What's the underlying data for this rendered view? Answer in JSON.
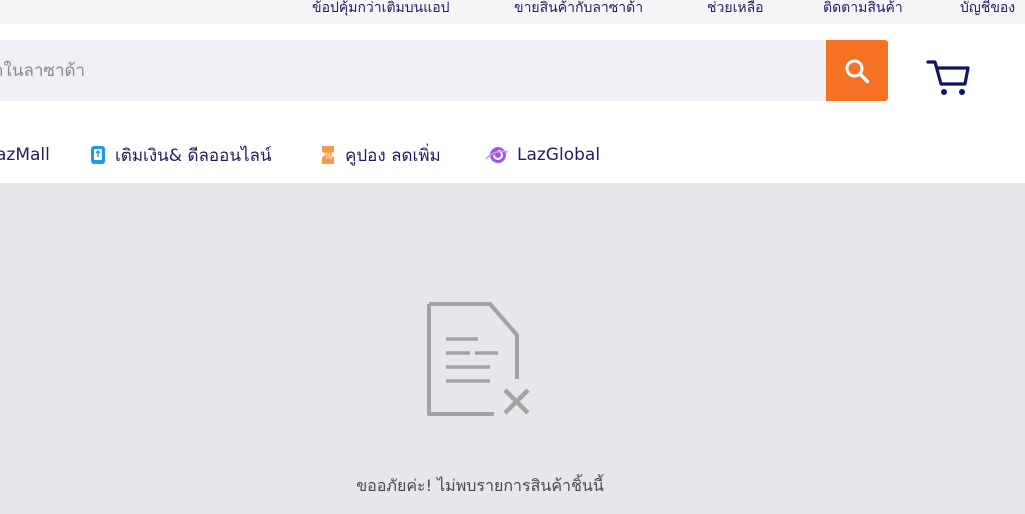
{
  "topbar": {
    "links": [
      "ข้อปคุ้มกว่าเติมบนแอป",
      "ขายสินค้ากับลาซาด้า",
      "ช่วยเหลือ",
      "ติดตามสินค้า",
      "บัญชีของ"
    ]
  },
  "search": {
    "placeholder": "าในลาซาด้า",
    "button_icon": "search-icon"
  },
  "cart": {
    "icon": "cart-icon"
  },
  "nav": {
    "items": [
      {
        "label": "azMall",
        "icon": ""
      },
      {
        "label": "เติมเงิน& ดีลออนไลน์",
        "icon": "phone-topup-icon"
      },
      {
        "label": "คูปอง ลดเพิ่ม",
        "icon": "coupon-icon"
      },
      {
        "label": "LazGlobal",
        "icon": "lazglobal-icon"
      }
    ]
  },
  "empty_state": {
    "icon": "document-not-found-icon",
    "message": "ขออภัยค่ะ! ไม่พบรายการสินค้าชิ้นนี้"
  },
  "colors": {
    "accent": "#f57224",
    "navy": "#1f1f5f",
    "page_bg": "#e6e7eb",
    "search_bg": "#eff0f5",
    "icon_gray": "#a3a3a3"
  }
}
